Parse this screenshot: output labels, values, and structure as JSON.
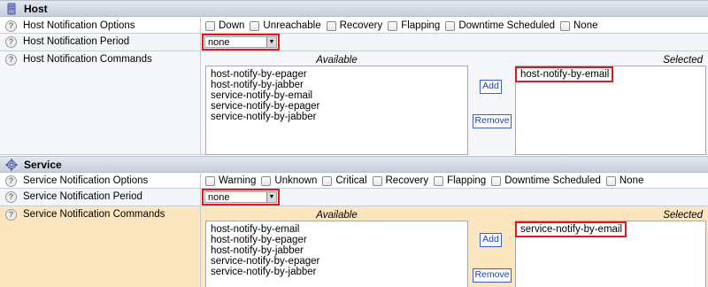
{
  "host": {
    "section_title": "Host",
    "notification_options": {
      "label": "Host Notification Options",
      "options": [
        "Down",
        "Unreachable",
        "Recovery",
        "Flapping",
        "Downtime Scheduled",
        "None"
      ]
    },
    "notification_period": {
      "label": "Host Notification Period",
      "value": "none"
    },
    "notification_commands": {
      "label": "Host Notification Commands",
      "available_header": "Available",
      "selected_header": "Selected",
      "available": [
        "host-notify-by-epager",
        "host-notify-by-jabber",
        "service-notify-by-email",
        "service-notify-by-epager",
        "service-notify-by-jabber"
      ],
      "selected": [
        "host-notify-by-email"
      ],
      "add_label": "Add",
      "remove_label": "Remove"
    }
  },
  "service": {
    "section_title": "Service",
    "notification_options": {
      "label": "Service Notification Options",
      "options": [
        "Warning",
        "Unknown",
        "Critical",
        "Recovery",
        "Flapping",
        "Downtime Scheduled",
        "None"
      ]
    },
    "notification_period": {
      "label": "Service Notification Period",
      "value": "none"
    },
    "notification_commands": {
      "label": "Service Notification Commands",
      "available_header": "Available",
      "selected_header": "Selected",
      "available": [
        "host-notify-by-email",
        "host-notify-by-epager",
        "host-notify-by-jabber",
        "service-notify-by-epager",
        "service-notify-by-jabber"
      ],
      "selected": [
        "service-notify-by-email"
      ],
      "add_label": "Add",
      "remove_label": "Remove"
    }
  },
  "icons": {
    "host": "server-icon",
    "service": "gear-icon",
    "help": "help-icon",
    "help_glyph": "?",
    "dropdown_glyph": "▼"
  },
  "colors": {
    "highlight": "#e0181e",
    "button_text": "#1a3fb0",
    "warm_row": "#fbe6c0"
  }
}
